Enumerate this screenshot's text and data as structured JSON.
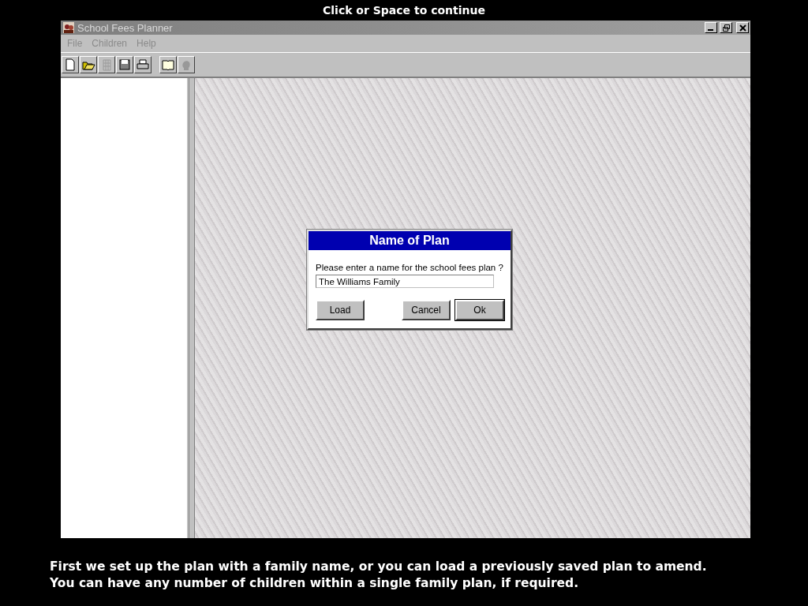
{
  "top_caption": "Click or Space to continue",
  "window": {
    "title": "School Fees Planner"
  },
  "menu": [
    "File",
    "Children",
    "Help"
  ],
  "toolbar": [
    {
      "kind": "new",
      "disabled": false
    },
    {
      "kind": "open",
      "disabled": false
    },
    {
      "kind": "grid",
      "disabled": true
    },
    {
      "kind": "save",
      "disabled": false
    },
    {
      "kind": "print",
      "disabled": false
    },
    {
      "kind": "book",
      "disabled": false
    },
    {
      "kind": "head",
      "disabled": true
    }
  ],
  "dialog": {
    "title": "Name of Plan",
    "prompt": "Please enter a name for the school fees plan ?",
    "value": "The Williams Family",
    "buttons": [
      {
        "label": "Load",
        "default": false
      },
      {
        "label": "Cancel",
        "default": false
      },
      {
        "label": "Ok",
        "default": true
      }
    ]
  },
  "bottom_caption": [
    "First we set up the plan with a family name, or you can load a previously saved plan to amend.",
    "You can have any number of children within a single family plan, if required."
  ]
}
